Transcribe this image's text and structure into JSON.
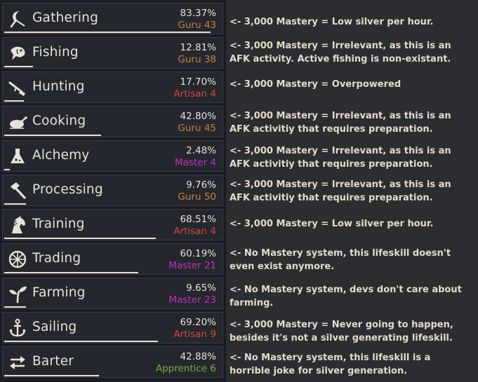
{
  "colors": {
    "guru": "#c8833f",
    "artisan": "#d0483a",
    "master": "#c02fbf",
    "apprentice": "#6fb040",
    "text": "#e8e2d6"
  },
  "skills": [
    {
      "name": "Gathering",
      "percent": "83.37%",
      "rank": "Guru 43",
      "tier": "guru",
      "progress": 0.94,
      "icon": "sickle-icon",
      "note": "<- 3,000 Mastery = Low silver per hour."
    },
    {
      "name": "Fishing",
      "percent": "12.81%",
      "rank": "Guru 38",
      "tier": "guru",
      "progress": 0.13,
      "icon": "fish-icon",
      "note": "<- 3,000 Mastery = Irrelevant, as this is an AFK activity. Active fishing is non-existant."
    },
    {
      "name": "Hunting",
      "percent": "17.70%",
      "rank": "Artisan 4",
      "tier": "artisan",
      "progress": 0.09,
      "icon": "musket-icon",
      "note": "<- 3,000 Mastery = Overpowered"
    },
    {
      "name": "Cooking",
      "percent": "42.80%",
      "rank": "Guru 45",
      "tier": "guru",
      "progress": 0.44,
      "icon": "roast-chicken-icon",
      "note": "<- 3,000 Mastery = Irrelevant, as this is an AFK activitiy that requires preparation."
    },
    {
      "name": "Alchemy",
      "percent": "2.48%",
      "rank": "Master 4",
      "tier": "master",
      "progress": 0.025,
      "icon": "flask-icon",
      "note": "<- 3,000 Mastery = Irrelevant, as this is an AFK activitiy that requires preparation."
    },
    {
      "name": "Processing",
      "percent": "9.76%",
      "rank": "Guru 50",
      "tier": "guru",
      "progress": 0.1,
      "icon": "hammer-icon",
      "note": "<- 3,000 Mastery = Irrelevant, as this is an AFK activitiy that requires preparation."
    },
    {
      "name": "Training",
      "percent": "68.51%",
      "rank": "Artisan 4",
      "tier": "artisan",
      "progress": 0.69,
      "icon": "horse-icon",
      "note": "<- 3,000 Mastery = Low silver per hour."
    },
    {
      "name": "Trading",
      "percent": "60.19%",
      "rank": "Master 21",
      "tier": "master",
      "progress": 0.61,
      "icon": "wheel-icon",
      "note": "<- No Mastery system, this lifeskill doesn't even exist anymore."
    },
    {
      "name": "Farming",
      "percent": "9.65%",
      "rank": "Master 23",
      "tier": "master",
      "progress": 0.1,
      "icon": "sprout-icon",
      "note": "<- No Mastery system, devs don't care about farming."
    },
    {
      "name": "Sailing",
      "percent": "69.20%",
      "rank": "Artisan 9",
      "tier": "artisan",
      "progress": 0.7,
      "icon": "anchor-icon",
      "note": "<- 3,000 Mastery = Never going to happen, besides it's not a silver generating lifeskill."
    },
    {
      "name": "Barter",
      "percent": "42.88%",
      "rank": "Apprentice 6",
      "tier": "apprentice",
      "progress": 0.43,
      "icon": "exchange-arrows-icon",
      "note": "<- No Mastery system, this lifeskill is a horrible joke for silver generation."
    }
  ]
}
